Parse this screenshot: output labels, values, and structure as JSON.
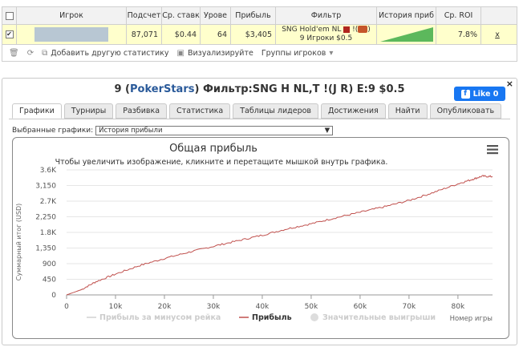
{
  "table": {
    "headers": [
      "Игрок",
      "Подсчет",
      "Ср. ставк",
      "Урове",
      "Прибыль",
      "Фильтр",
      "История приб",
      "Ср. ROI"
    ],
    "row": {
      "count": "87,071",
      "avg_stake": "$0.44",
      "level": "64",
      "profit": "$3,405",
      "filter_line1": "SNG Hold'em NL",
      "filter_mark": "!(",
      "filter_mark_end": ")",
      "filter_line2": "9 Игроки $0.5",
      "roi": "7.8%",
      "remove": "x"
    }
  },
  "toolbar": {
    "add_stats": "Добавить другую статистику",
    "visualize": "Визуализируйте",
    "groups": "Группы игроков"
  },
  "panel": {
    "title_prefix": "9 (",
    "site": "PokerStars",
    "title_suffix": ") Фильтр:SNG H NL,T !(J R) E:9 $0.5",
    "close": "×",
    "fb_like": "Like 0",
    "tabs": [
      "Графики",
      "Турниры",
      "Разбивка",
      "Статистика",
      "Таблицы лидеров",
      "Достижения",
      "Найти",
      "Опубликовать"
    ],
    "selected_charts_label": "Выбранные графики:",
    "selected_chart": "История прибыли"
  },
  "colors": {
    "accent": "#2a5a9a",
    "highlight_row": "#ffffcc",
    "line": "#c0504d",
    "fb": "#1877f2"
  },
  "chart_data": {
    "type": "line",
    "title": "Общая прибыль",
    "subtitle": "Чтобы увеличить изображение, кликните и перетащите мышкой внутрь графика.",
    "ylabel": "Суммарный итог (USD)",
    "xlabel": "Номер игры",
    "xlim": [
      0,
      87071
    ],
    "ylim": [
      0,
      3600
    ],
    "x_ticks": [
      0,
      10000,
      20000,
      30000,
      40000,
      50000,
      60000,
      70000,
      80000
    ],
    "x_tick_labels": [
      "0",
      "10k",
      "20k",
      "30k",
      "40k",
      "50k",
      "60k",
      "70k",
      "80k"
    ],
    "y_ticks": [
      0,
      450,
      900,
      1350,
      1800,
      2250,
      2700,
      3150,
      3600
    ],
    "y_tick_labels": [
      "0",
      "450",
      "900",
      "1,350",
      "1.8K",
      "2,250",
      "2.7K",
      "3,150",
      "3.6K"
    ],
    "legend": [
      "Прибыль за минусом рейка",
      "Прибыль",
      "Значительные выигрыши"
    ],
    "legend_placement": "bottom",
    "series": [
      {
        "name": "Прибыль",
        "x": [
          0,
          3000,
          6000,
          10000,
          15000,
          20000,
          25000,
          30000,
          35000,
          40000,
          45000,
          50000,
          55000,
          60000,
          65000,
          70000,
          75000,
          80000,
          83000,
          85000,
          87071
        ],
        "values": [
          0,
          150,
          380,
          600,
          850,
          1050,
          1230,
          1400,
          1560,
          1720,
          1900,
          2050,
          2220,
          2380,
          2540,
          2720,
          2950,
          3200,
          3330,
          3420,
          3405
        ]
      }
    ]
  }
}
